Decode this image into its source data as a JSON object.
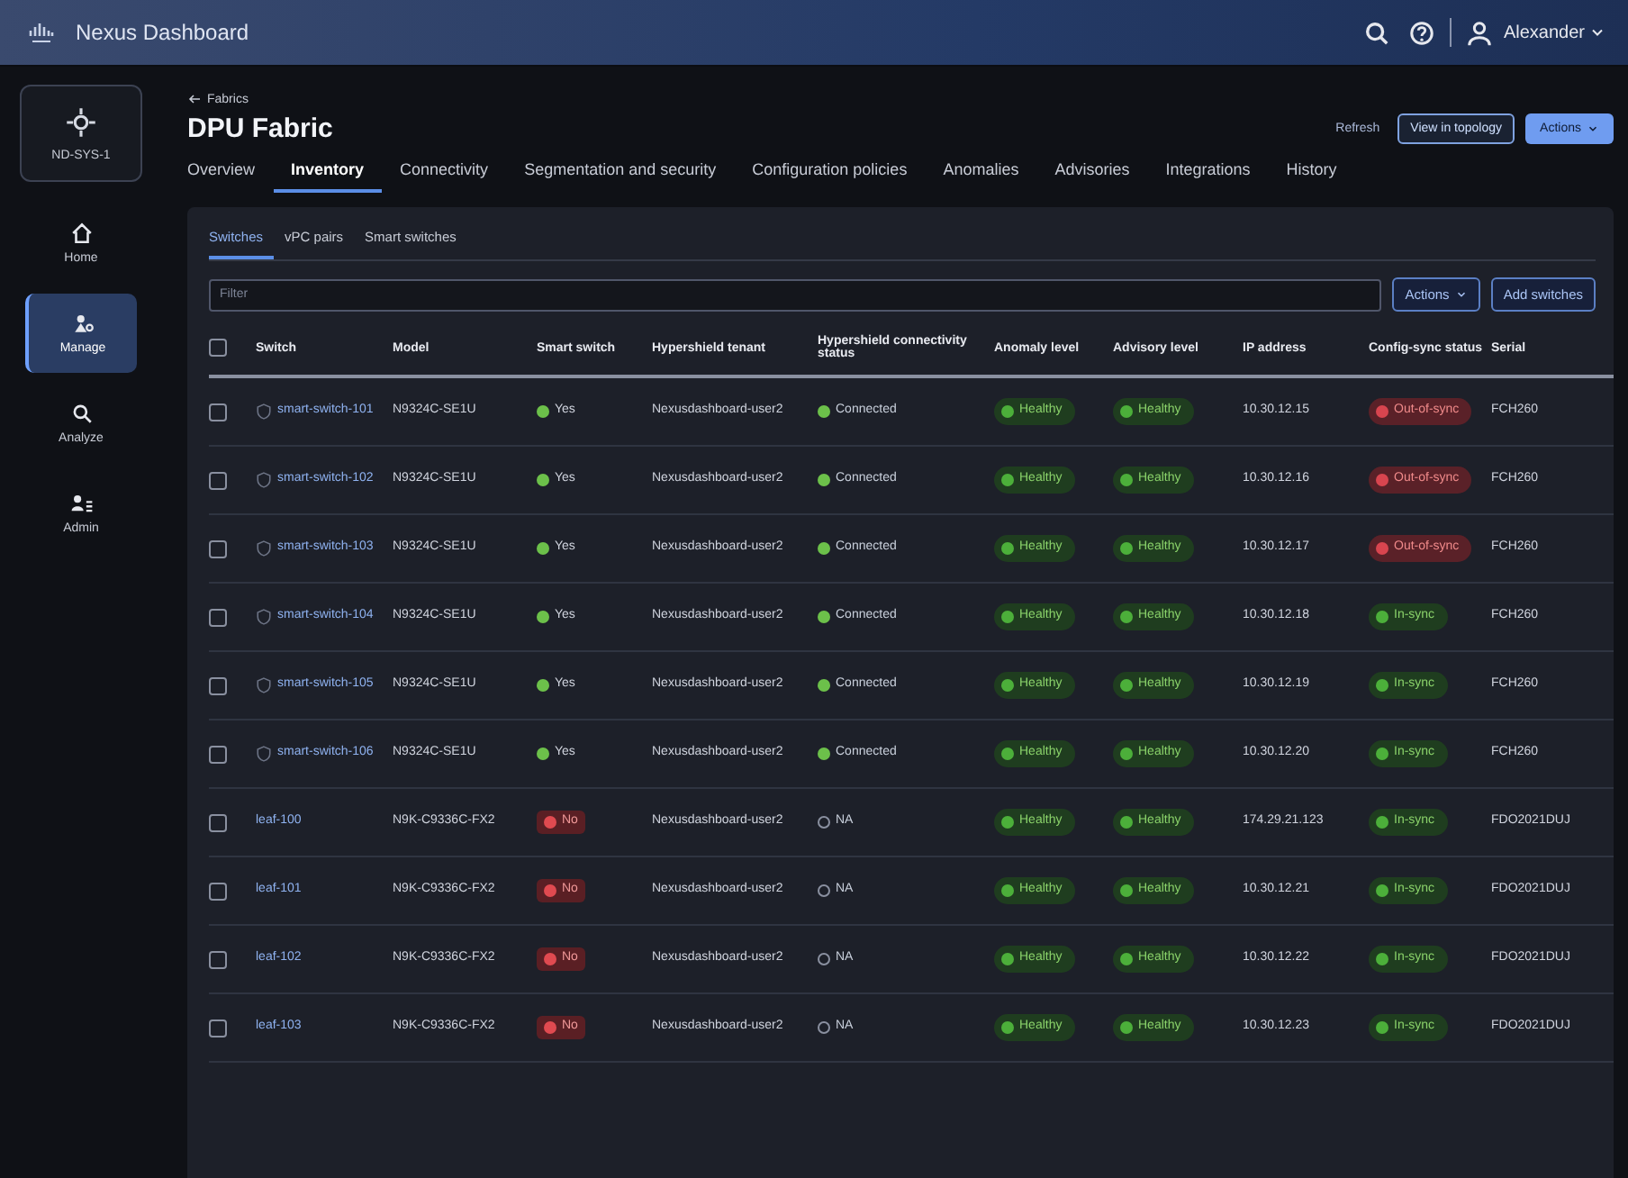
{
  "app": {
    "brand": "Nexus Dashboard",
    "user": "Alexander"
  },
  "sidebar": {
    "site": "ND-SYS-1",
    "items": [
      {
        "label": "Home",
        "kind": "home",
        "selected": false
      },
      {
        "label": "Manage",
        "kind": "manage",
        "selected": true
      },
      {
        "label": "Analyze",
        "kind": "analyze",
        "selected": false
      },
      {
        "label": "Admin",
        "kind": "admin",
        "selected": false
      }
    ]
  },
  "breadcrumb": "Fabrics",
  "title": "DPU Fabric",
  "header_actions": {
    "refresh": "Refresh",
    "topology": "View in topology",
    "actions": "Actions"
  },
  "tabs": [
    {
      "label": "Overview",
      "selected": false
    },
    {
      "label": "Inventory",
      "selected": true
    },
    {
      "label": "Connectivity",
      "selected": false
    },
    {
      "label": "Segmentation and security",
      "selected": false
    },
    {
      "label": "Configuration policies",
      "selected": false
    },
    {
      "label": "Anomalies",
      "selected": false
    },
    {
      "label": "Advisories",
      "selected": false
    },
    {
      "label": "Integrations",
      "selected": false
    },
    {
      "label": "History",
      "selected": false
    }
  ],
  "subtabs": [
    {
      "label": "Switches",
      "selected": true
    },
    {
      "label": "vPC pairs",
      "selected": false
    },
    {
      "label": "Smart switches",
      "selected": false
    }
  ],
  "filter": {
    "placeholder": "Filter"
  },
  "table_actions": {
    "actions": "Actions",
    "add": "Add switches"
  },
  "table": {
    "all_selected": false,
    "columns": [
      "Switch",
      "Model",
      "Smart switch",
      "Hypershield tenant",
      "Hypershield connectivity status",
      "Anomaly level",
      "Advisory level",
      "IP address",
      "Config-sync status",
      "Serial"
    ],
    "rows": [
      {
        "selected": false,
        "kind": "smart",
        "switch": "smart-switch-101",
        "model": "N9324C-SE1U",
        "smart": {
          "text": "Yes",
          "on": true
        },
        "tenant": "Nexusdashboard-user2",
        "connectivity": {
          "text": "Connected",
          "kind": "connected"
        },
        "anomaly": {
          "text": "Healthy",
          "kind": "healthy"
        },
        "advisory": {
          "text": "Healthy",
          "kind": "healthy"
        },
        "ip": "10.30.12.15",
        "sync": {
          "text": "Out-of-sync",
          "kind": "out"
        },
        "serial": "FCH260"
      },
      {
        "selected": false,
        "kind": "smart",
        "switch": "smart-switch-102",
        "model": "N9324C-SE1U",
        "smart": {
          "text": "Yes",
          "on": true
        },
        "tenant": "Nexusdashboard-user2",
        "connectivity": {
          "text": "Connected",
          "kind": "connected"
        },
        "anomaly": {
          "text": "Healthy",
          "kind": "healthy"
        },
        "advisory": {
          "text": "Healthy",
          "kind": "healthy"
        },
        "ip": "10.30.12.16",
        "sync": {
          "text": "Out-of-sync",
          "kind": "out"
        },
        "serial": "FCH260"
      },
      {
        "selected": false,
        "kind": "smart",
        "switch": "smart-switch-103",
        "model": "N9324C-SE1U",
        "smart": {
          "text": "Yes",
          "on": true
        },
        "tenant": "Nexusdashboard-user2",
        "connectivity": {
          "text": "Connected",
          "kind": "connected"
        },
        "anomaly": {
          "text": "Healthy",
          "kind": "healthy"
        },
        "advisory": {
          "text": "Healthy",
          "kind": "healthy"
        },
        "ip": "10.30.12.17",
        "sync": {
          "text": "Out-of-sync",
          "kind": "out"
        },
        "serial": "FCH260"
      },
      {
        "selected": false,
        "kind": "smart",
        "switch": "smart-switch-104",
        "model": "N9324C-SE1U",
        "smart": {
          "text": "Yes",
          "on": true
        },
        "tenant": "Nexusdashboard-user2",
        "connectivity": {
          "text": "Connected",
          "kind": "connected"
        },
        "anomaly": {
          "text": "Healthy",
          "kind": "healthy"
        },
        "advisory": {
          "text": "Healthy",
          "kind": "healthy"
        },
        "ip": "10.30.12.18",
        "sync": {
          "text": "In-sync",
          "kind": "in"
        },
        "serial": "FCH260"
      },
      {
        "selected": false,
        "kind": "smart",
        "switch": "smart-switch-105",
        "model": "N9324C-SE1U",
        "smart": {
          "text": "Yes",
          "on": true
        },
        "tenant": "Nexusdashboard-user2",
        "connectivity": {
          "text": "Connected",
          "kind": "connected"
        },
        "anomaly": {
          "text": "Healthy",
          "kind": "healthy"
        },
        "advisory": {
          "text": "Healthy",
          "kind": "healthy"
        },
        "ip": "10.30.12.19",
        "sync": {
          "text": "In-sync",
          "kind": "in"
        },
        "serial": "FCH260"
      },
      {
        "selected": false,
        "kind": "smart",
        "switch": "smart-switch-106",
        "model": "N9324C-SE1U",
        "smart": {
          "text": "Yes",
          "on": true
        },
        "tenant": "Nexusdashboard-user2",
        "connectivity": {
          "text": "Connected",
          "kind": "connected"
        },
        "anomaly": {
          "text": "Healthy",
          "kind": "healthy"
        },
        "advisory": {
          "text": "Healthy",
          "kind": "healthy"
        },
        "ip": "10.30.12.20",
        "sync": {
          "text": "In-sync",
          "kind": "in"
        },
        "serial": "FCH260"
      },
      {
        "selected": false,
        "kind": "leaf",
        "switch": "leaf-100",
        "model": "N9K-C9336C-FX2",
        "smart": {
          "text": "No",
          "on": false
        },
        "tenant": "Nexusdashboard-user2",
        "connectivity": {
          "text": "NA",
          "kind": "na"
        },
        "anomaly": {
          "text": "Healthy",
          "kind": "healthy"
        },
        "advisory": {
          "text": "Healthy",
          "kind": "healthy"
        },
        "ip": "174.29.21.123",
        "sync": {
          "text": "In-sync",
          "kind": "in"
        },
        "serial": "FDO2021DUJ"
      },
      {
        "selected": false,
        "kind": "leaf",
        "switch": "leaf-101",
        "model": "N9K-C9336C-FX2",
        "smart": {
          "text": "No",
          "on": false
        },
        "tenant": "Nexusdashboard-user2",
        "connectivity": {
          "text": "NA",
          "kind": "na"
        },
        "anomaly": {
          "text": "Healthy",
          "kind": "healthy"
        },
        "advisory": {
          "text": "Healthy",
          "kind": "healthy"
        },
        "ip": "10.30.12.21",
        "sync": {
          "text": "In-sync",
          "kind": "in"
        },
        "serial": "FDO2021DUJ"
      },
      {
        "selected": false,
        "kind": "leaf",
        "switch": "leaf-102",
        "model": "N9K-C9336C-FX2",
        "smart": {
          "text": "No",
          "on": false
        },
        "tenant": "Nexusdashboard-user2",
        "connectivity": {
          "text": "NA",
          "kind": "na"
        },
        "anomaly": {
          "text": "Healthy",
          "kind": "healthy"
        },
        "advisory": {
          "text": "Healthy",
          "kind": "healthy"
        },
        "ip": "10.30.12.22",
        "sync": {
          "text": "In-sync",
          "kind": "in"
        },
        "serial": "FDO2021DUJ"
      },
      {
        "selected": false,
        "kind": "leaf",
        "switch": "leaf-103",
        "model": "N9K-C9336C-FX2",
        "smart": {
          "text": "No",
          "on": false
        },
        "tenant": "Nexusdashboard-user2",
        "connectivity": {
          "text": "NA",
          "kind": "na"
        },
        "anomaly": {
          "text": "Healthy",
          "kind": "healthy"
        },
        "advisory": {
          "text": "Healthy",
          "kind": "healthy"
        },
        "ip": "10.30.12.23",
        "sync": {
          "text": "In-sync",
          "kind": "in"
        },
        "serial": "FDO2021DUJ"
      }
    ]
  }
}
